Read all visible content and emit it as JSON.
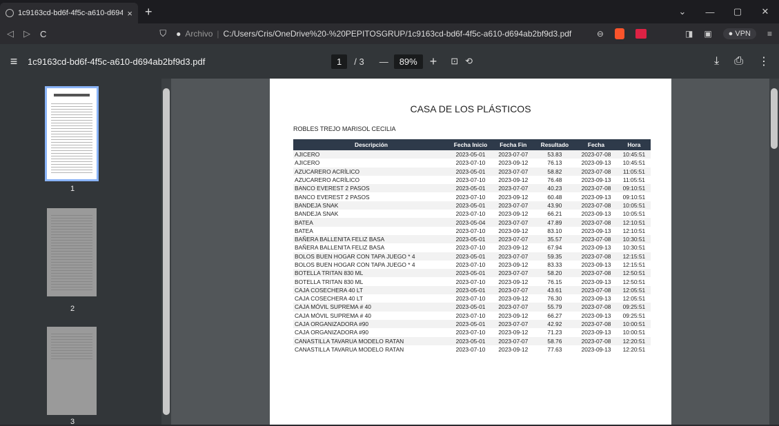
{
  "tab": {
    "title": "1c9163cd-bd6f-4f5c-a610-d694a",
    "close": "×",
    "new": "+"
  },
  "window_controls": {
    "min": "—",
    "max": "▢",
    "close": "✕",
    "chev": "⌄"
  },
  "address": {
    "label": "Archivo",
    "url": "C:/Users/Cris/OneDrive%20-%20PEPITOSGRUP/1c9163cd-bd6f-4f5c-a610-d694ab2bf9d3.pdf",
    "vpn": "● VPN"
  },
  "pdf_toolbar": {
    "filename": "1c9163cd-bd6f-4f5c-a610-d694ab2bf9d3.pdf",
    "page_current": "1",
    "page_total": "/ 3",
    "zoom": "89%",
    "minus": "—",
    "plus": "+"
  },
  "thumbnails": [
    {
      "num": "1"
    },
    {
      "num": "2"
    },
    {
      "num": "3"
    }
  ],
  "document": {
    "title": "CASA DE LOS PLÁSTICOS",
    "client": "ROBLES TREJO MARISOL CECILIA",
    "headers": [
      "Descripción",
      "Fecha Inicio",
      "Fecha Fin",
      "Resultado",
      "Fecha",
      "Hora"
    ],
    "rows": [
      [
        "AJICERO",
        "2023-05-01",
        "2023-07-07",
        "53.83",
        "2023-07-08",
        "10:45:51"
      ],
      [
        "AJICERO",
        "2023-07-10",
        "2023-09-12",
        "76.13",
        "2023-09-13",
        "10:45:51"
      ],
      [
        "AZUCARERO ACRÍLICO",
        "2023-05-01",
        "2023-07-07",
        "58.82",
        "2023-07-08",
        "11:05:51"
      ],
      [
        "AZUCARERO ACRÍLICO",
        "2023-07-10",
        "2023-09-12",
        "76.48",
        "2023-09-13",
        "11:05:51"
      ],
      [
        "BANCO EVEREST 2 PASOS",
        "2023-05-01",
        "2023-07-07",
        "40.23",
        "2023-07-08",
        "09:10:51"
      ],
      [
        "BANCO EVEREST 2 PASOS",
        "2023-07-10",
        "2023-09-12",
        "60.48",
        "2023-09-13",
        "09:10:51"
      ],
      [
        "BANDEJA SNAK",
        "2023-05-01",
        "2023-07-07",
        "43.90",
        "2023-07-08",
        "10:05:51"
      ],
      [
        "BANDEJA SNAK",
        "2023-07-10",
        "2023-09-12",
        "66.21",
        "2023-09-13",
        "10:05:51"
      ],
      [
        "BATEA",
        "2023-05-04",
        "2023-07-07",
        "47.89",
        "2023-07-08",
        "12:10:51"
      ],
      [
        "BATEA",
        "2023-07-10",
        "2023-09-12",
        "83.10",
        "2023-09-13",
        "12:10:51"
      ],
      [
        "BAÑERA BALLENITA FELIZ BASA",
        "2023-05-01",
        "2023-07-07",
        "35.57",
        "2023-07-08",
        "10:30:51"
      ],
      [
        "BAÑERA BALLENITA FELIZ BASA",
        "2023-07-10",
        "2023-09-12",
        "67.94",
        "2023-09-13",
        "10:30:51"
      ],
      [
        "BOLOS BUEN HOGAR CON TAPA JUEGO * 4",
        "2023-05-01",
        "2023-07-07",
        "59.35",
        "2023-07-08",
        "12:15:51"
      ],
      [
        "BOLOS BUEN HOGAR CON TAPA JUEGO * 4",
        "2023-07-10",
        "2023-09-12",
        "83.33",
        "2023-09-13",
        "12:15:51"
      ],
      [
        "BOTELLA TRITAN 830 ML",
        "2023-05-01",
        "2023-07-07",
        "58.20",
        "2023-07-08",
        "12:50:51"
      ],
      [
        "BOTELLA TRITAN 830 ML",
        "2023-07-10",
        "2023-09-12",
        "76.15",
        "2023-09-13",
        "12:50:51"
      ],
      [
        "CAJA COSECHERA 40 LT",
        "2023-05-01",
        "2023-07-07",
        "43.61",
        "2023-07-08",
        "12:05:51"
      ],
      [
        "CAJA COSECHERA 40 LT",
        "2023-07-10",
        "2023-09-12",
        "76.30",
        "2023-09-13",
        "12:05:51"
      ],
      [
        "CAJA MÓVIL SUPREMA # 40",
        "2023-05-01",
        "2023-07-07",
        "55.79",
        "2023-07-08",
        "09:25:51"
      ],
      [
        "CAJA MÓVIL SUPREMA # 40",
        "2023-07-10",
        "2023-09-12",
        "66.27",
        "2023-09-13",
        "09:25:51"
      ],
      [
        "CAJA ORGANIZADORA #90",
        "2023-05-01",
        "2023-07-07",
        "42.92",
        "2023-07-08",
        "10:00:51"
      ],
      [
        "CAJA ORGANIZADORA #90",
        "2023-07-10",
        "2023-09-12",
        "71.23",
        "2023-09-13",
        "10:00:51"
      ],
      [
        "CANASTILLA TAVARUA MODELO RATAN",
        "2023-05-01",
        "2023-07-07",
        "58.76",
        "2023-07-08",
        "12:20:51"
      ],
      [
        "CANASTILLA TAVARUA MODELO RATAN",
        "2023-07-10",
        "2023-09-12",
        "77.63",
        "2023-09-13",
        "12:20:51"
      ]
    ]
  }
}
